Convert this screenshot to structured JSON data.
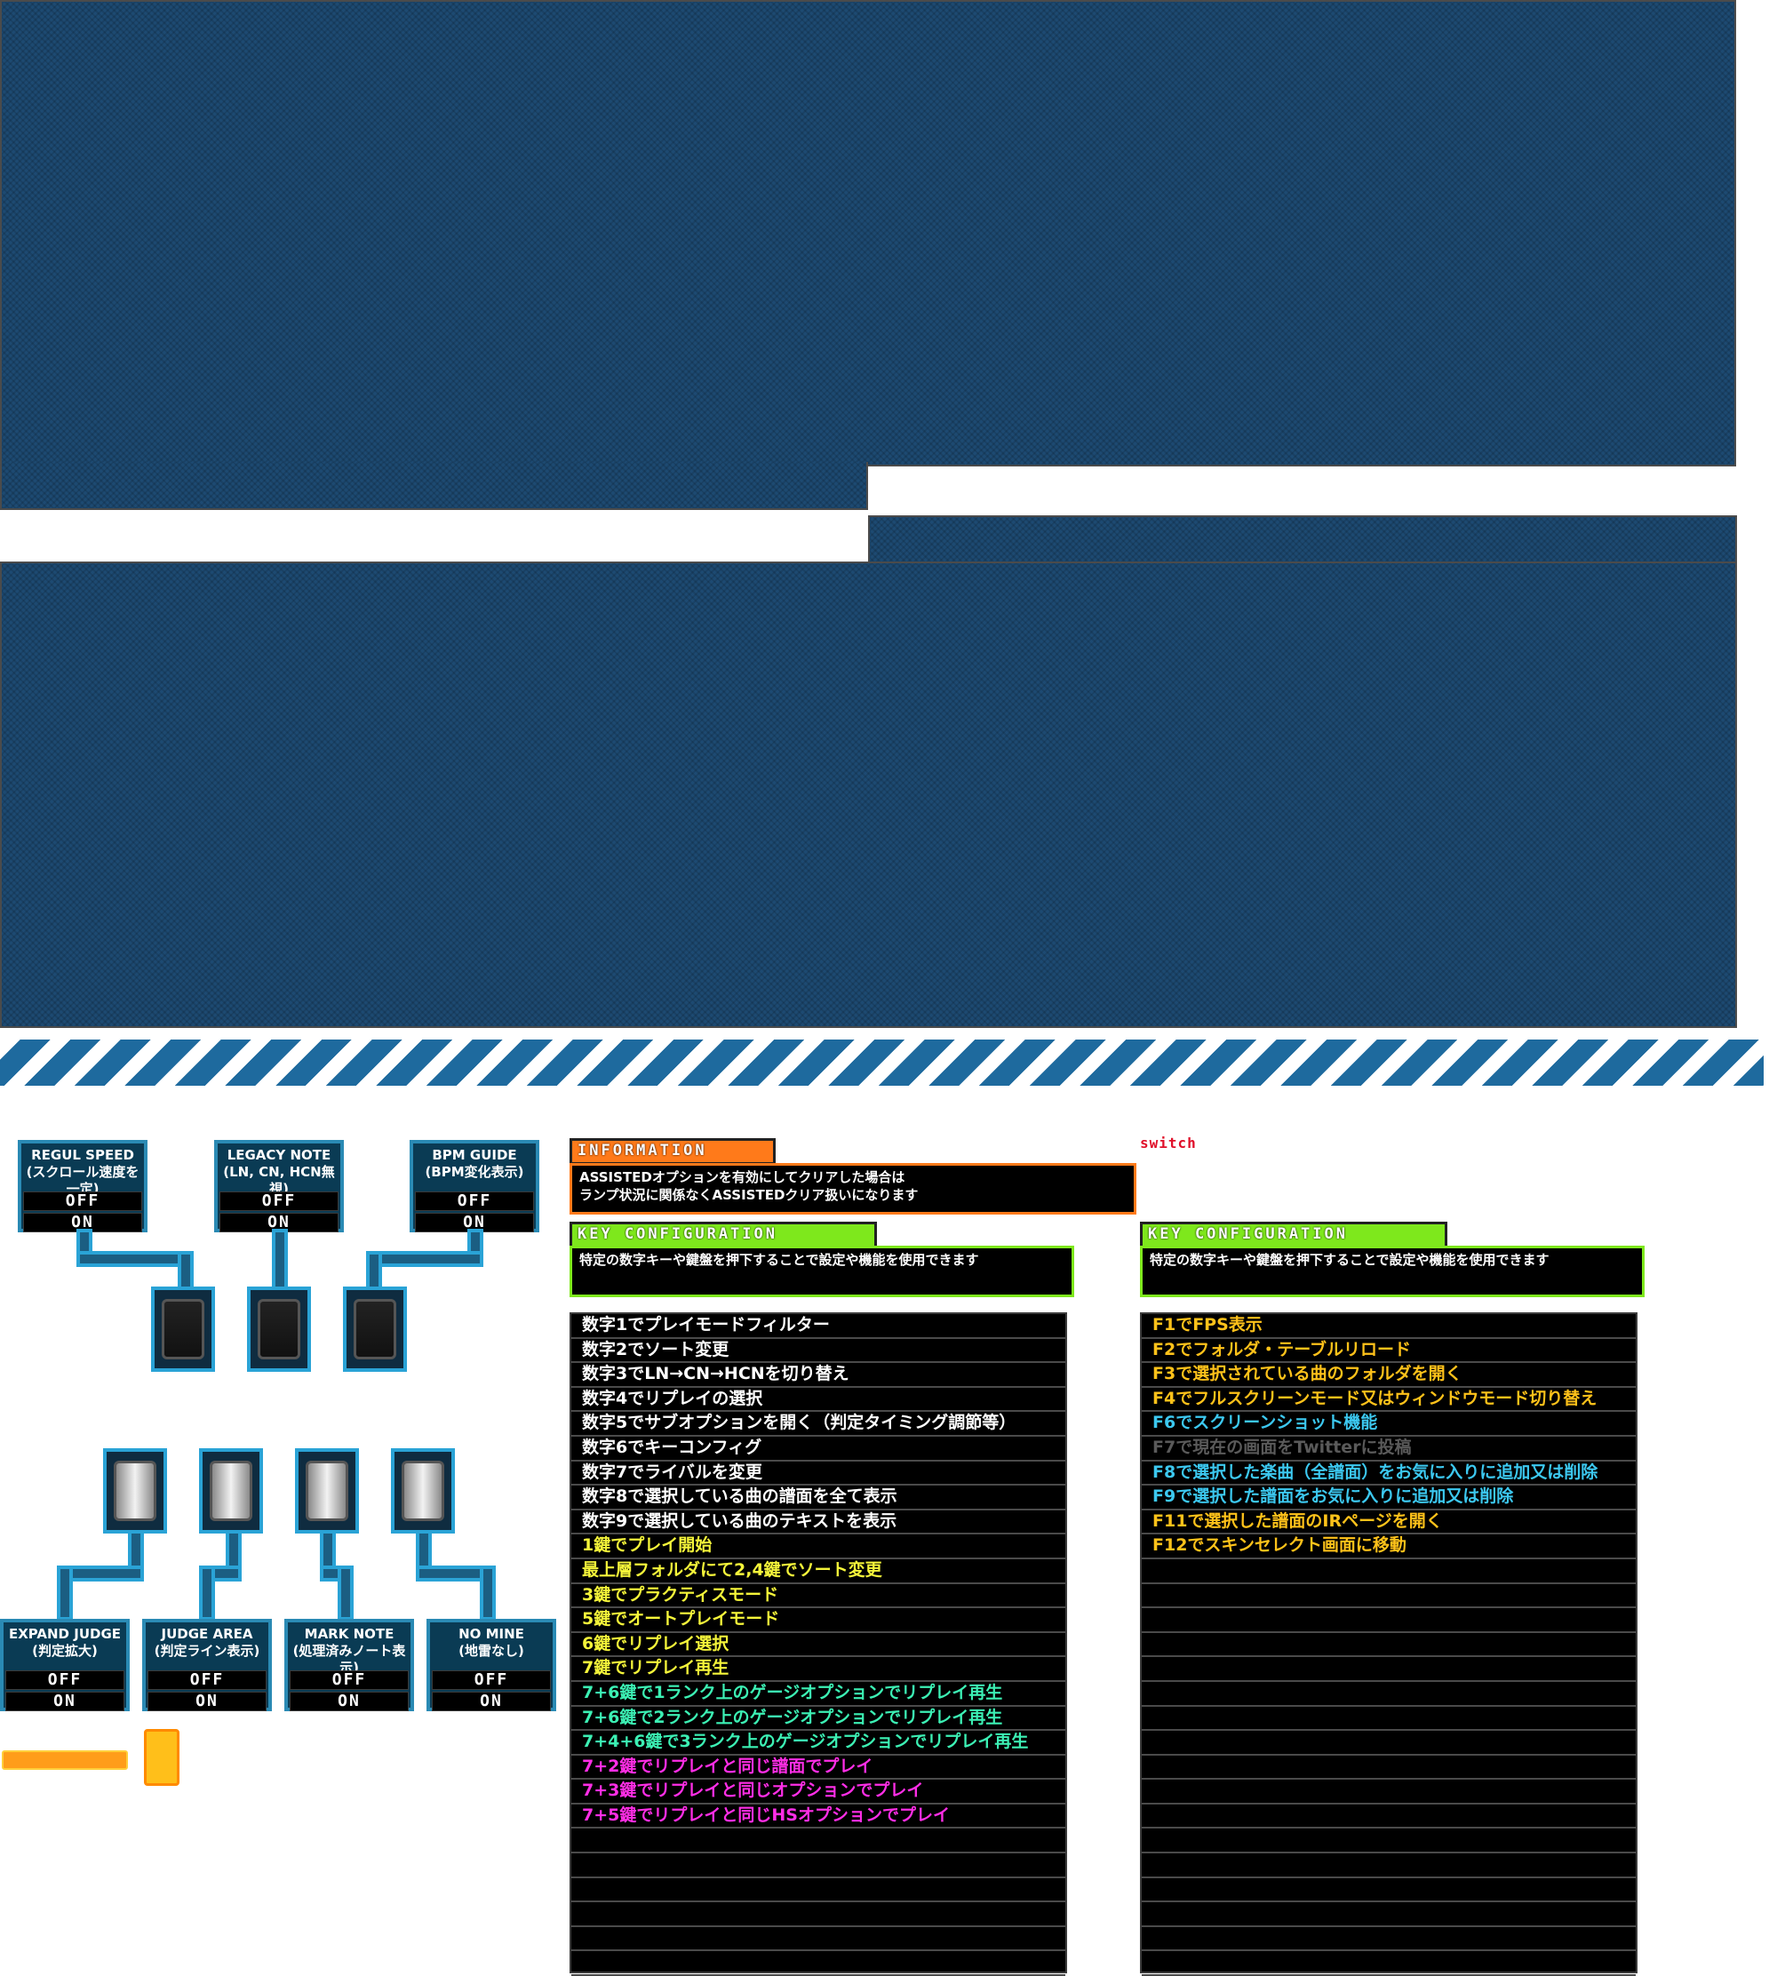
{
  "options": {
    "regul_speed": {
      "title": "REGUL SPEED\n(スクロール速度を一定)",
      "off": "OFF",
      "on": "ON"
    },
    "legacy_note": {
      "title": "LEGACY NOTE\n(LN, CN, HCN無視)",
      "off": "OFF",
      "on": "ON"
    },
    "bpm_guide": {
      "title": "BPM GUIDE\n(BPM変化表示)",
      "off": "OFF",
      "on": "ON"
    },
    "expand_judge": {
      "title": "EXPAND JUDGE\n(判定拡大)",
      "off": "OFF",
      "on": "ON"
    },
    "judge_area": {
      "title": "JUDGE AREA\n(判定ライン表示)",
      "off": "OFF",
      "on": "ON"
    },
    "mark_note": {
      "title": "MARK NOTE\n(処理済みノート表示)",
      "off": "OFF",
      "on": "ON"
    },
    "no_mine": {
      "title": "NO MINE\n(地雷なし)",
      "off": "OFF",
      "on": "ON"
    }
  },
  "information": {
    "tab": "INFORMATION",
    "text": "ASSISTEDオプションを有効にしてクリアした場合は\nランプ状況に関係なくASSISTEDクリア扱いになります"
  },
  "switch_label": "switch",
  "key_config_left": {
    "tab": "KEY CONFIGURATION",
    "text": "特定の数字キーや鍵盤を押下することで設定や機能を使用できます"
  },
  "key_config_right": {
    "tab": "KEY CONFIGURATION",
    "text": "特定の数字キーや鍵盤を押下することで設定や機能を使用できます"
  },
  "left_list": [
    {
      "text": "数字1でプレイモードフィルター",
      "color": "#ffffff"
    },
    {
      "text": "数字2でソート変更",
      "color": "#ffffff"
    },
    {
      "text": "数字3でLN→CN→HCNを切り替え",
      "color": "#ffffff"
    },
    {
      "text": "数字4でリプレイの選択",
      "color": "#ffffff"
    },
    {
      "text": "数字5でサブオプションを開く（判定タイミング調節等）",
      "color": "#ffffff"
    },
    {
      "text": "数字6でキーコンフィグ",
      "color": "#ffffff"
    },
    {
      "text": "数字7でライバルを変更",
      "color": "#ffffff"
    },
    {
      "text": "数字8で選択している曲の譜面を全て表示",
      "color": "#ffffff"
    },
    {
      "text": "数字9で選択している曲のテキストを表示",
      "color": "#ffffff"
    },
    {
      "text": "1鍵でプレイ開始",
      "color": "#f5f53a"
    },
    {
      "text": "最上層フォルダにて2,4鍵でソート変更",
      "color": "#f5f53a"
    },
    {
      "text": "3鍵でプラクティスモード",
      "color": "#f5f53a"
    },
    {
      "text": "5鍵でオートプレイモード",
      "color": "#f5f53a"
    },
    {
      "text": "6鍵でリプレイ選択",
      "color": "#f5f53a"
    },
    {
      "text": "7鍵でリプレイ再生",
      "color": "#f5f53a"
    },
    {
      "text": "7+6鍵で1ランク上のゲージオプションでリプレイ再生",
      "color": "#3cf0b4"
    },
    {
      "text": "7+6鍵で2ランク上のゲージオプションでリプレイ再生",
      "color": "#3cf0b4"
    },
    {
      "text": "7+4+6鍵で3ランク上のゲージオプションでリプレイ再生",
      "color": "#3cf0b4"
    },
    {
      "text": "7+2鍵でリプレイと同じ譜面でプレイ",
      "color": "#ff2ee6"
    },
    {
      "text": "7+3鍵でリプレイと同じオプションでプレイ",
      "color": "#ff2ee6"
    },
    {
      "text": "7+5鍵でリプレイと同じHSオプションでプレイ",
      "color": "#ff2ee6"
    },
    {
      "text": "",
      "color": "#ffffff"
    },
    {
      "text": "",
      "color": "#ffffff"
    },
    {
      "text": "",
      "color": "#ffffff"
    },
    {
      "text": "",
      "color": "#ffffff"
    },
    {
      "text": "",
      "color": "#ffffff"
    },
    {
      "text": "",
      "color": "#ffffff"
    }
  ],
  "right_list": [
    {
      "text": "F1でFPS表示",
      "color": "#ffc21a"
    },
    {
      "text": "F2でフォルダ・テーブルリロード",
      "color": "#ffc21a"
    },
    {
      "text": "F3で選択されている曲のフォルダを開く",
      "color": "#ffc21a"
    },
    {
      "text": "F4でフルスクリーンモード又はウィンドウモード切り替え",
      "color": "#ffc21a"
    },
    {
      "text": "F6でスクリーンショット機能",
      "color": "#3cc8f0"
    },
    {
      "text": "F7で現在の画面をTwitterに投稿",
      "color": "#5a5a5a"
    },
    {
      "text": "F8で選択した楽曲（全譜面）をお気に入りに追加又は削除",
      "color": "#3cc8f0"
    },
    {
      "text": "F9で選択した譜面をお気に入りに追加又は削除",
      "color": "#3cc8f0"
    },
    {
      "text": "F11で選択した譜面のIRページを開く",
      "color": "#ffc21a"
    },
    {
      "text": "F12でスキンセレクト画面に移動",
      "color": "#ffc21a"
    },
    {
      "text": "",
      "color": "#ffffff"
    },
    {
      "text": "",
      "color": "#ffffff"
    },
    {
      "text": "",
      "color": "#ffffff"
    },
    {
      "text": "",
      "color": "#ffffff"
    },
    {
      "text": "",
      "color": "#ffffff"
    },
    {
      "text": "",
      "color": "#ffffff"
    },
    {
      "text": "",
      "color": "#ffffff"
    },
    {
      "text": "",
      "color": "#ffffff"
    },
    {
      "text": "",
      "color": "#ffffff"
    },
    {
      "text": "",
      "color": "#ffffff"
    },
    {
      "text": "",
      "color": "#ffffff"
    },
    {
      "text": "",
      "color": "#ffffff"
    },
    {
      "text": "",
      "color": "#ffffff"
    },
    {
      "text": "",
      "color": "#ffffff"
    },
    {
      "text": "",
      "color": "#ffffff"
    },
    {
      "text": "",
      "color": "#ffffff"
    },
    {
      "text": "",
      "color": "#ffffff"
    }
  ],
  "colors": {
    "navy_panel": "#1d4a72",
    "option_border": "#2aa3d6",
    "info_orange": "#ff7a1a",
    "keyconfig_green": "#7ee81c",
    "switch_red": "#e0102a",
    "bar_orange": "#ff9d1a"
  }
}
